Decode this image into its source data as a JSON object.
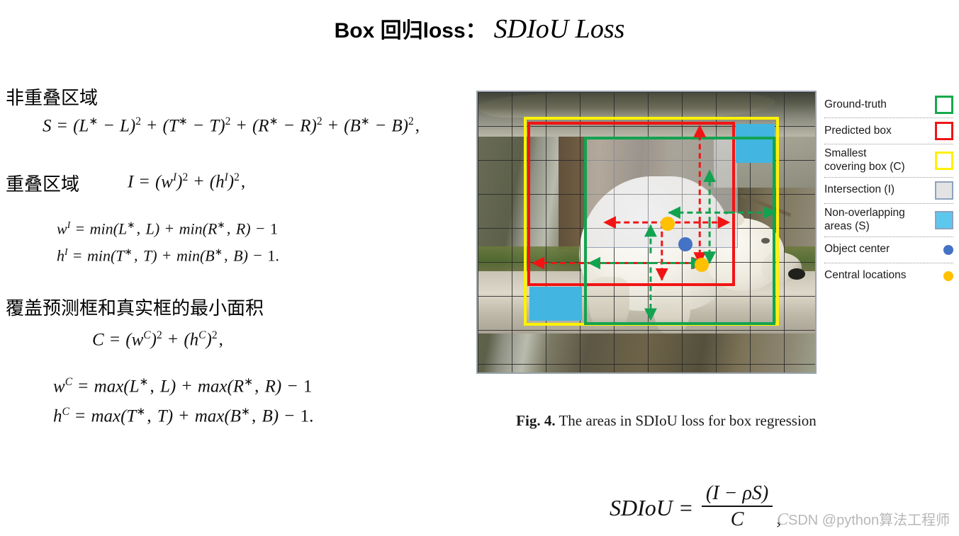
{
  "title": {
    "cn": "Box 回归loss：",
    "math": "SDIoU Loss"
  },
  "left_column": {
    "heading_nonoverlap": "非重叠区域",
    "heading_overlap": "重叠区域",
    "heading_cover": "覆盖预测框和真实框的最小面积",
    "formula_S": "S = (L* − L)² + (T* − T)² + (R* − R)² + (B* − B)²,",
    "formula_I": "I = (wᴵ)² + (hᴵ)²,",
    "formula_wI": "wᴵ = min(L*, L) + min(R*, R) − 1",
    "formula_hI": "hᴵ = min(T*, T) + min(B*, B) − 1.",
    "formula_C": "C = (w^C)² + (h^C)²,",
    "formula_wC": "w^C = max(L*, L) + max(R*, R) − 1",
    "formula_hC": "h^C = max(T*, T) + max(B*, B) − 1."
  },
  "figure": {
    "caption_number": "Fig. 4.",
    "caption_text": "The areas in SDIoU loss for box regression",
    "alt": "polar bear photo with grid and bounding box overlays"
  },
  "legend": {
    "items": [
      {
        "label": "Ground-truth",
        "swatch": "green-outline-box",
        "color": "#16A94E"
      },
      {
        "label": "Predicted box",
        "swatch": "red-outline-box",
        "color": "#F01414"
      },
      {
        "label": "Smallest\ncovering box (C)",
        "swatch": "yellow-outline-box",
        "color": "#FFF000"
      },
      {
        "label": "Intersection (I)",
        "swatch": "gray-filled-box",
        "color": "#E3E3E3"
      },
      {
        "label": "Non-overlapping\nareas (S)",
        "swatch": "cyan-filled-box",
        "color": "#5CC8EE"
      },
      {
        "label": "Object center",
        "swatch": "blue-dot",
        "color": "#4472C4"
      },
      {
        "label": "Central locations",
        "swatch": "orange-dot",
        "color": "#FFC000"
      }
    ]
  },
  "bottom_formula": {
    "lhs": "SDIoU",
    "equals": "=",
    "numerator": "(I − ρS)",
    "denominator": "C",
    "trailing": ","
  },
  "watermark": {
    "brand_initial": "C",
    "text": "SDN @python算法工程师"
  }
}
